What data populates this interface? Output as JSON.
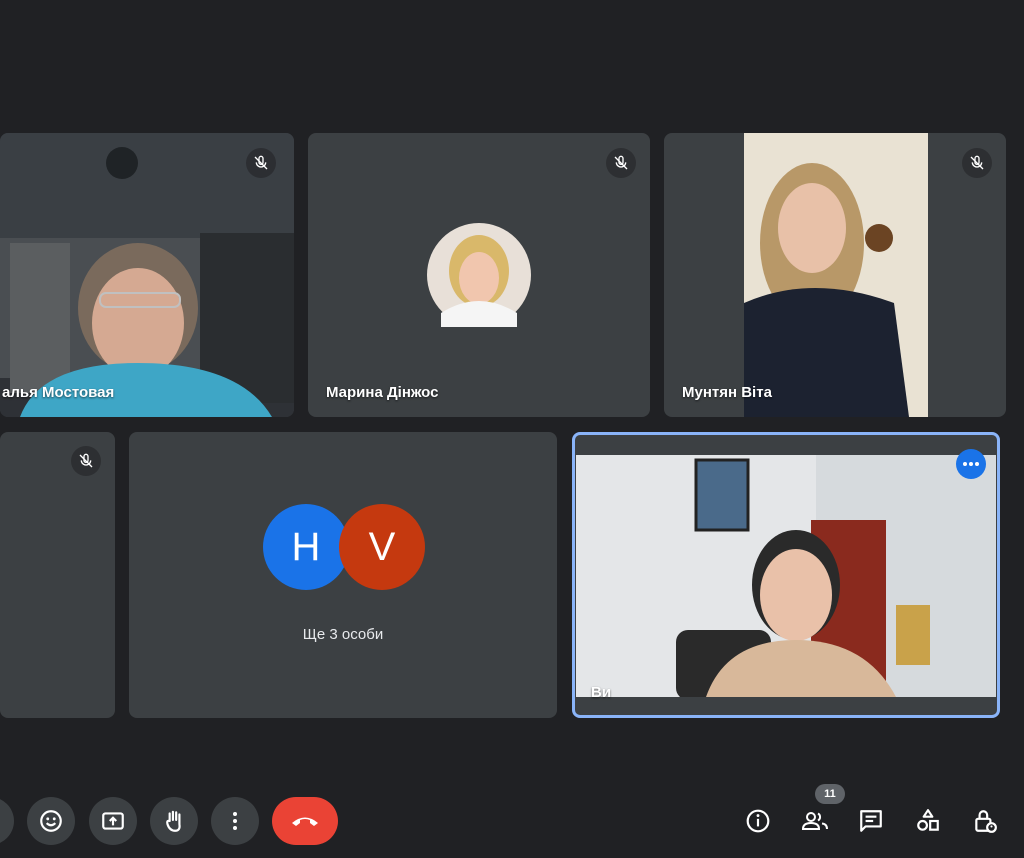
{
  "participants": [
    {
      "name": "алья Мостовая",
      "muted": true
    },
    {
      "name": "Марина Дінжос",
      "muted": true
    },
    {
      "name": "Мунтян Віта",
      "muted": true
    },
    {
      "name": "",
      "muted": true
    },
    {
      "name": "Ви",
      "muted": false
    }
  ],
  "group_tile": {
    "letters": [
      "H",
      "V"
    ],
    "label": "Ще 3 особи",
    "colors": [
      "#1a73e8",
      "#c5390f"
    ]
  },
  "toolbar": {
    "end_call_color": "#ea4335",
    "participants_count": "11",
    "left_icons": [
      "emoji-icon",
      "present-screen-icon",
      "raise-hand-icon",
      "more-options-icon",
      "end-call-icon"
    ],
    "right_icons": [
      "info-icon",
      "people-icon",
      "chat-icon",
      "activities-icon",
      "host-controls-icon"
    ]
  },
  "accent": "#8ab4f8"
}
